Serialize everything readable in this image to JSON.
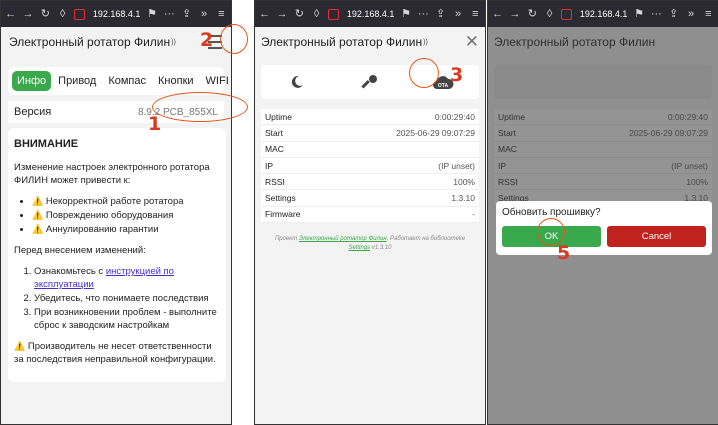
{
  "browser": {
    "url": "192.168.4.1",
    "more": "···",
    "menu": "≡",
    "overflow": "»"
  },
  "app": {
    "title": "Электронный ротатор Филин",
    "signal_glyph": "📶"
  },
  "tabs": [
    "Инфо",
    "Привод",
    "Компас",
    "Кнопки",
    "WIFI"
  ],
  "version": {
    "label": "Версия",
    "value": "8.9.2 PCB_855XL"
  },
  "warning": {
    "heading": "ВНИМАНИЕ",
    "intro": "Изменение настроек электронного ротатора ФИЛИН может привести к:",
    "risks": [
      "Некорректной работе ротатора",
      "Повреждению оборудования",
      "Аннулированию гарантии"
    ],
    "before": "Перед внесением изменений:",
    "steps_1_prefix": "Ознакомьтесь с ",
    "steps_1_link": "инструкцией по эксплуатации",
    "steps_2": "Убедитесь, что понимаете последствия",
    "steps_3": "При возникновении проблем - выполните сброс к заводским настройкам",
    "disclaimer": "Производитель не несет ответственности за последствия неправильной конфигурации.",
    "emoji": "⚠️"
  },
  "info_rows": [
    {
      "k": "Uptime",
      "v": "0:00:29:40"
    },
    {
      "k": "Start",
      "v": "2025-06-29 09:07:29"
    },
    {
      "k": "MAC",
      "v": ""
    },
    {
      "k": "IP",
      "v": "(IP unset)"
    },
    {
      "k": "RSSI",
      "v": "100%"
    },
    {
      "k": "Settings",
      "v": "1.3.10"
    },
    {
      "k": "Firmware",
      "v": "-"
    }
  ],
  "footnote": {
    "prefix": "Проект ",
    "link1": "Электронный ротатор Филин",
    "middle": ". Работает на библиотеке ",
    "link2": "Settings",
    "suffix": " v1.3.10"
  },
  "ota_label": "OTA",
  "dialog": {
    "question": "Обновить прошивку?",
    "ok": "OK",
    "cancel": "Cancel"
  },
  "annotations": [
    "1",
    "2",
    "3",
    "5"
  ],
  "colors": {
    "accent": "#3aa84c",
    "danger": "#c0221e",
    "annotation": "#e8551a"
  }
}
